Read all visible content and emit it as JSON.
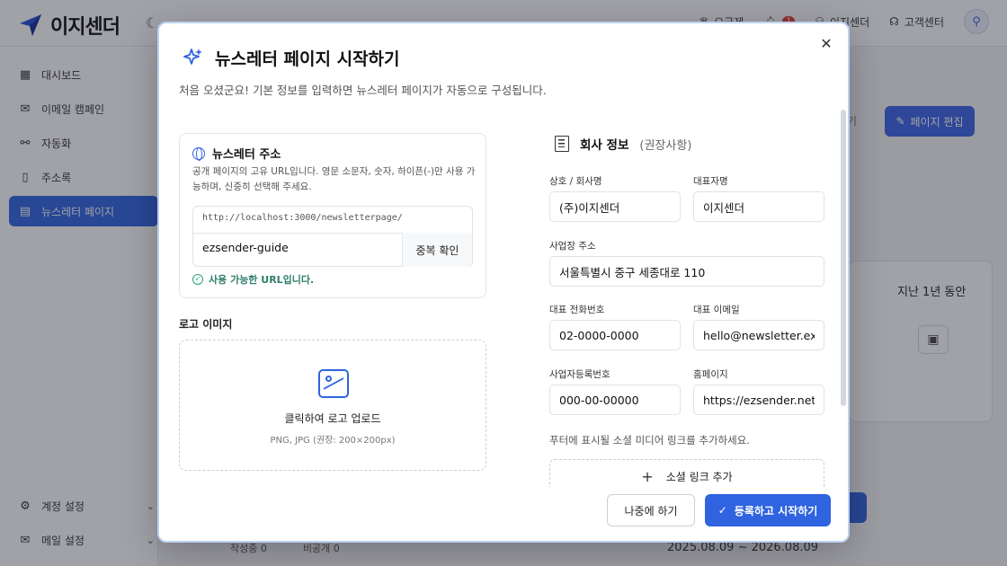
{
  "app": {
    "name": "이지센더",
    "top_items": [
      {
        "label": "요금제",
        "icon": "crown-icon"
      },
      {
        "label": "",
        "badge": "1",
        "icon": "bell-icon"
      },
      {
        "label": "이지센더",
        "icon": "user-icon"
      },
      {
        "label": "고객센터",
        "icon": "headset-icon"
      }
    ],
    "accent_color": "#2f63e0"
  },
  "sidebar": {
    "items": [
      {
        "label": "대시보드",
        "icon": "grid-icon"
      },
      {
        "label": "이메일 캠페인",
        "icon": "mail-icon"
      },
      {
        "label": "자동화",
        "icon": "automation-icon"
      },
      {
        "label": "주소록",
        "icon": "book-icon"
      },
      {
        "label": "뉴스레터 페이지",
        "icon": "newspaper-icon",
        "active": true
      }
    ],
    "bottom": [
      {
        "label": "계정 설정",
        "icon": "gear-icon"
      },
      {
        "label": "메일 설정",
        "icon": "mail-settings-icon"
      }
    ]
  },
  "background": {
    "edit_button": "페이지 편집",
    "partial_text": "기",
    "period_label": "지난 1년 동안",
    "date_range": "2025.08.09 ~ 2026.08.09",
    "tags": [
      "작성중 0",
      "비공개 0"
    ]
  },
  "modal": {
    "title": "뉴스레터 페이지 시작하기",
    "subtitle": "처음 오셨군요! 기본 정보를 입력하면 뉴스레터 페이지가 자동으로 구성됩니다.",
    "url_section": {
      "title": "뉴스레터 주소",
      "desc": "공개 페이지의 고유 URL입니다. 영문 소문자, 숫자, 하이픈(-)만 사용 가능하며, 신중히 선택해 주세요.",
      "prefix": "http://localhost:3000/newsletterpage/",
      "value": "ezsender-guide",
      "check_button": "중복 확인",
      "status": "사용 가능한 URL입니다."
    },
    "logo_section": {
      "label": "로고 이미지",
      "upload_text": "클릭하여 로고 업로드",
      "hint": "PNG, JPG (권장: 200×200px)"
    },
    "company": {
      "title": "회사 정보",
      "recommended": "(권장사항)",
      "fields": {
        "company_name": {
          "label": "상호 / 회사명",
          "value": "(주)이지센더"
        },
        "ceo": {
          "label": "대표자명",
          "value": "이지센더"
        },
        "address": {
          "label": "사업장 주소",
          "value": "서울특별시 중구 세종대로 110"
        },
        "phone": {
          "label": "대표 전화번호",
          "value": "02-0000-0000"
        },
        "email": {
          "label": "대표 이메일",
          "value": "hello@newsletter.exam"
        },
        "biz_no": {
          "label": "사업자등록번호",
          "value": "000-00-00000"
        },
        "homepage": {
          "label": "홈페이지",
          "value": "https://ezsender.net"
        }
      },
      "social_hint": "푸터에 표시될 소셜 미디어 링크를 추가하세요.",
      "social_button": "소셜 링크 추가"
    },
    "footer": {
      "later": "나중에 하기",
      "start": "등록하고 시작하기"
    }
  }
}
